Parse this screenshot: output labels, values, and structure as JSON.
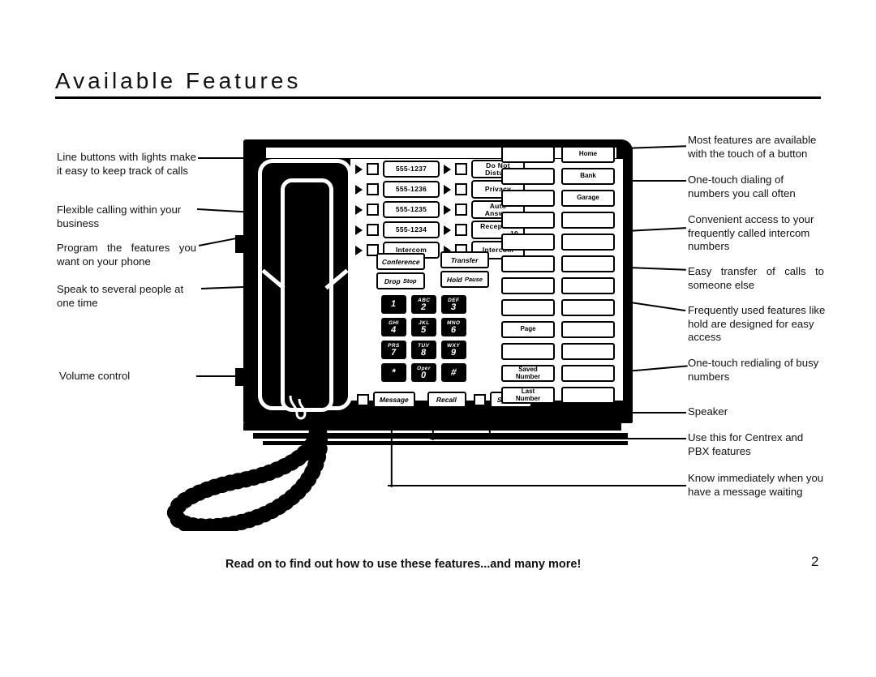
{
  "page": {
    "title": "Available Features",
    "footer_caption": "Read on to find out how to use these features...and many more!",
    "page_number": "2"
  },
  "callouts_left": [
    {
      "id": "line-buttons",
      "text": "Line buttons with lights make it easy to keep track of calls"
    },
    {
      "id": "flexible-calling",
      "text": "Flexible calling within your business"
    },
    {
      "id": "program-features",
      "text": "Program the features you want on your phone"
    },
    {
      "id": "conference",
      "text": "Speak to several people at one time"
    },
    {
      "id": "volume-control",
      "text": "Volume control"
    }
  ],
  "callouts_right": [
    {
      "id": "touch-of-a-button",
      "text": "Most features are available with the touch of a button"
    },
    {
      "id": "one-touch-dialing",
      "text": "One-touch dialing of numbers you call often"
    },
    {
      "id": "intercom-access",
      "text": "Convenient access to your frequently called intercom numbers"
    },
    {
      "id": "easy-transfer",
      "text": "Easy transfer of calls to someone else"
    },
    {
      "id": "frequently-used",
      "text": "Frequently used features like hold are designed for easy access"
    },
    {
      "id": "redial-busy",
      "text": "One-touch redialing of busy numbers"
    },
    {
      "id": "speaker",
      "text": "Speaker"
    },
    {
      "id": "centrex-pbx",
      "text": "Use this for Centrex and PBX features"
    },
    {
      "id": "message-waiting",
      "text": "Know immediately when you have a message waiting"
    }
  ],
  "phone": {
    "line_buttons_left": [
      {
        "label": "555-1237"
      },
      {
        "label": "555-1236"
      },
      {
        "label": "555-1235"
      },
      {
        "label": "555-1234"
      },
      {
        "label": "Intercom"
      }
    ],
    "line_buttons_right": [
      {
        "line1": "Do Not",
        "line2": "Disturb"
      },
      {
        "line1": "Privacy",
        "line2": ""
      },
      {
        "line1": "Auto",
        "line2": "Answer"
      },
      {
        "line1": "Reception",
        "line2": "10"
      },
      {
        "line1": "Intercom",
        "line2": ""
      }
    ],
    "function_keys": [
      {
        "id": "conference",
        "label": "Conference",
        "sub": ""
      },
      {
        "id": "transfer",
        "label": "Transfer",
        "sub": ""
      },
      {
        "id": "drop",
        "label": "Drop",
        "sub": "Stop"
      },
      {
        "id": "hold",
        "label": "Hold",
        "sub": "Pause"
      }
    ],
    "keypad": [
      {
        "digit": "1",
        "alpha": ""
      },
      {
        "digit": "2",
        "alpha": "ABC"
      },
      {
        "digit": "3",
        "alpha": "DEF"
      },
      {
        "digit": "4",
        "alpha": "GHI"
      },
      {
        "digit": "5",
        "alpha": "JKL"
      },
      {
        "digit": "6",
        "alpha": "MNO"
      },
      {
        "digit": "7",
        "alpha": "PRS"
      },
      {
        "digit": "8",
        "alpha": "TUV"
      },
      {
        "digit": "9",
        "alpha": "WXY"
      },
      {
        "digit": "*",
        "alpha": ""
      },
      {
        "digit": "0",
        "alpha": "Oper"
      },
      {
        "digit": "#",
        "alpha": ""
      }
    ],
    "bottom_keys": [
      {
        "id": "message",
        "label": "Message",
        "has_led": true
      },
      {
        "id": "recall",
        "label": "Recall",
        "has_led": false
      },
      {
        "id": "speaker",
        "label": "Speaker",
        "has_led": true
      }
    ],
    "dss_buttons": [
      {
        "col": "left",
        "row": 1,
        "line1": "",
        "line2": ""
      },
      {
        "col": "right",
        "row": 1,
        "line1": "Home",
        "line2": ""
      },
      {
        "col": "left",
        "row": 2,
        "line1": "",
        "line2": ""
      },
      {
        "col": "right",
        "row": 2,
        "line1": "Bank",
        "line2": ""
      },
      {
        "col": "left",
        "row": 3,
        "line1": "",
        "line2": ""
      },
      {
        "col": "right",
        "row": 3,
        "line1": "Garage",
        "line2": ""
      },
      {
        "col": "left",
        "row": 4,
        "line1": "",
        "line2": ""
      },
      {
        "col": "right",
        "row": 4,
        "line1": "",
        "line2": ""
      },
      {
        "col": "left",
        "row": 5,
        "line1": "",
        "line2": ""
      },
      {
        "col": "right",
        "row": 5,
        "line1": "",
        "line2": ""
      },
      {
        "col": "left",
        "row": 6,
        "line1": "",
        "line2": ""
      },
      {
        "col": "right",
        "row": 6,
        "line1": "",
        "line2": ""
      },
      {
        "col": "left",
        "row": 7,
        "line1": "",
        "line2": ""
      },
      {
        "col": "right",
        "row": 7,
        "line1": "",
        "line2": ""
      },
      {
        "col": "left",
        "row": 8,
        "line1": "",
        "line2": ""
      },
      {
        "col": "right",
        "row": 8,
        "line1": "",
        "line2": ""
      },
      {
        "col": "left",
        "row": 9,
        "line1": "Page",
        "line2": ""
      },
      {
        "col": "right",
        "row": 9,
        "line1": "",
        "line2": ""
      },
      {
        "col": "left",
        "row": 10,
        "line1": "",
        "line2": ""
      },
      {
        "col": "right",
        "row": 10,
        "line1": "",
        "line2": ""
      },
      {
        "col": "left",
        "row": 11,
        "line1": "Saved",
        "line2": "Number"
      },
      {
        "col": "right",
        "row": 11,
        "line1": "",
        "line2": ""
      },
      {
        "col": "left",
        "row": 12,
        "line1": "Last",
        "line2": "Number"
      },
      {
        "col": "right",
        "row": 12,
        "line1": "",
        "line2": ""
      }
    ]
  },
  "colors": {
    "ink": "#000000",
    "paper": "#ffffff",
    "text": "#111111"
  }
}
